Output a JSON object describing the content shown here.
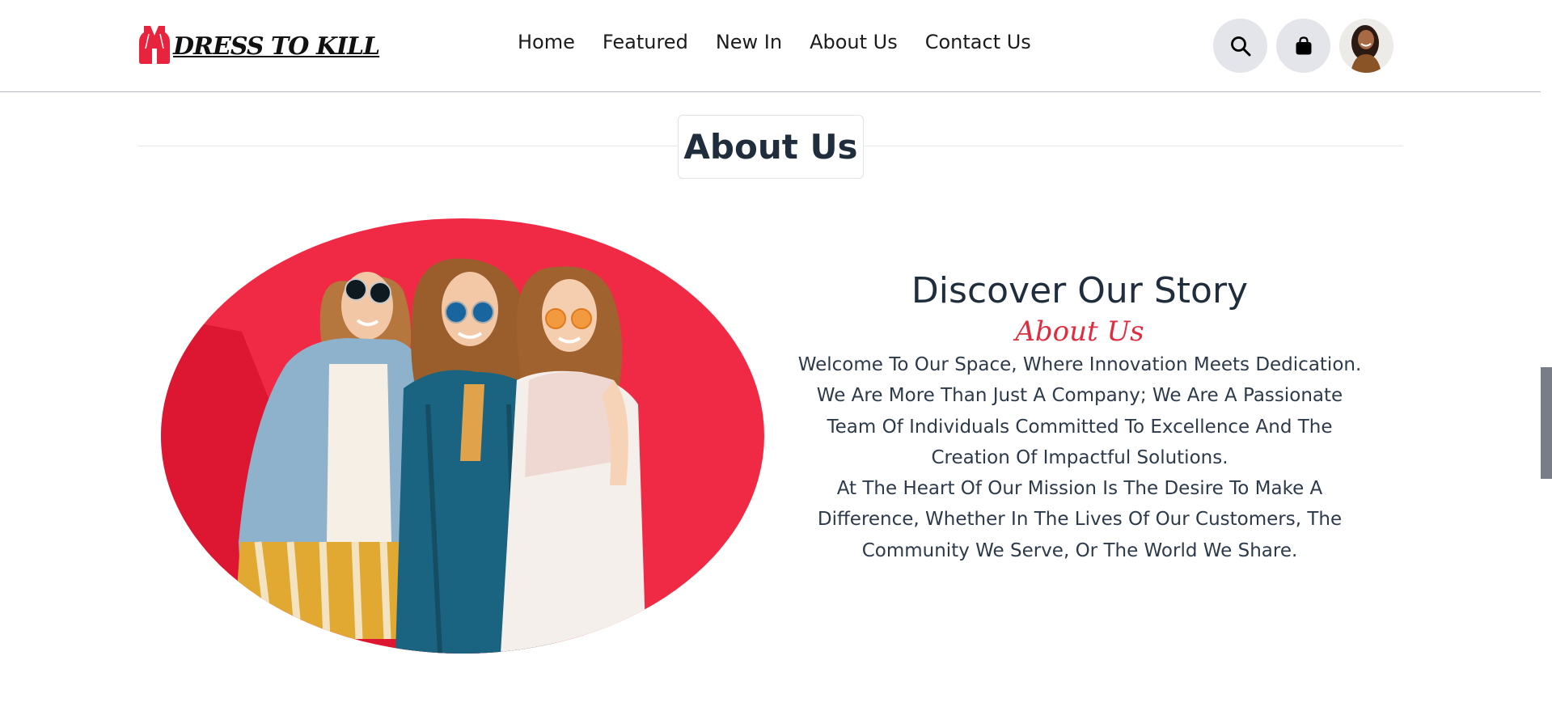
{
  "brand": {
    "name": "DRESS TO KILL",
    "accent_color": "#e8233e"
  },
  "nav": {
    "items": [
      "Home",
      "Featured",
      "New In",
      "About Us",
      "Contact Us"
    ]
  },
  "header_icons": {
    "search": "search-icon",
    "bag": "shopping-bag-icon",
    "profile": "avatar"
  },
  "section": {
    "title": "About Us"
  },
  "story": {
    "heading": "Discover Our Story",
    "subheading": "About Us",
    "lines": [
      "Welcome To Our Space, Where Innovation Meets Dedication.",
      "We Are More Than Just A Company; We Are A Passionate",
      "Team Of Individuals Committed To Excellence And The",
      "Creation Of Impactful Solutions.",
      "At The Heart Of Our Mission Is The Desire To Make A",
      "Difference, Whether In The Lives Of Our Customers, The",
      "Community We Serve, Or The World We Share."
    ]
  }
}
